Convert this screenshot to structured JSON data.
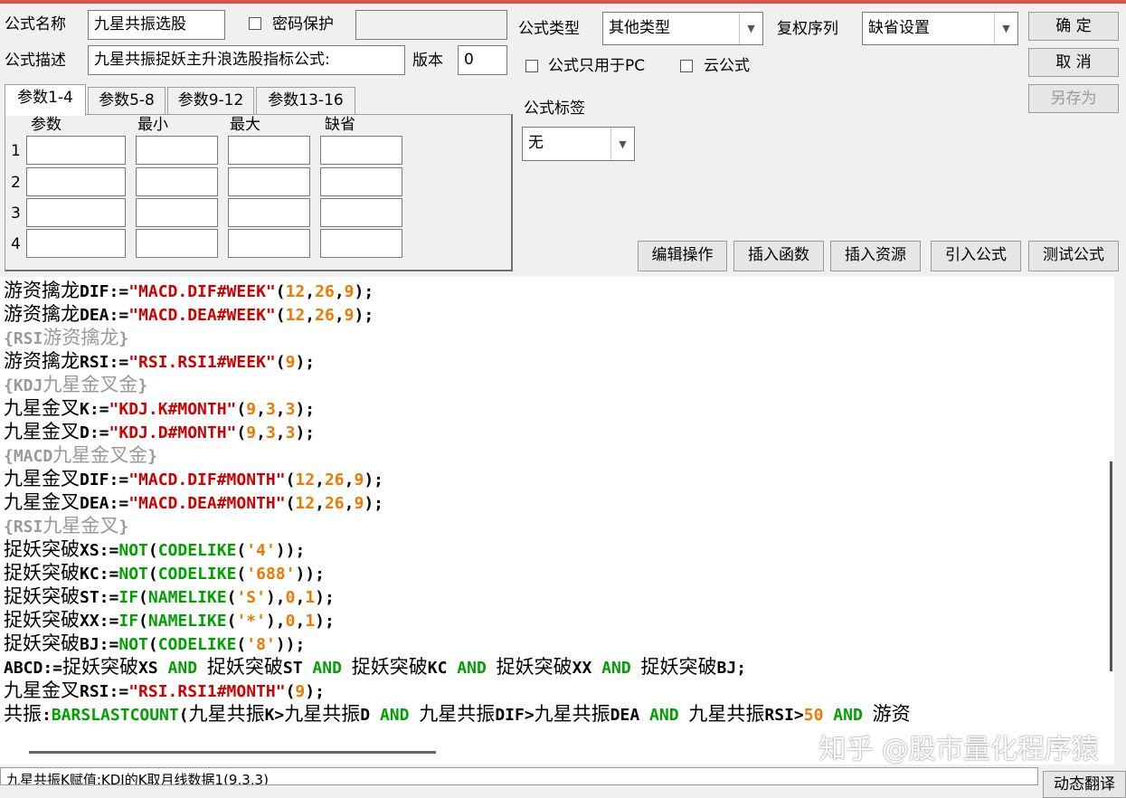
{
  "form": {
    "name_label": "公式名称",
    "name_value": "九星共振选股",
    "password_label": "密码保护",
    "desc_label": "公式描述",
    "desc_value": "九星共振捉妖主升浪选股指标公式:",
    "version_label": "版本",
    "version_value": "0",
    "type_label": "公式类型",
    "type_value": "其他类型",
    "rights_label": "复权序列",
    "rights_value": "缺省设置",
    "pc_only_label": "公式只用于PC",
    "cloud_label": "云公式",
    "tag_label": "公式标签",
    "tag_value": "无"
  },
  "buttons": {
    "ok": "确 定",
    "cancel": "取 消",
    "save_as": "另存为",
    "edit_ops": "编辑操作",
    "insert_func": "插入函数",
    "insert_res": "插入资源",
    "import_formula": "引入公式",
    "test_formula": "测试公式",
    "dynamic_translate": "动态翻译"
  },
  "params": {
    "tabs": [
      "参数1-4",
      "参数5-8",
      "参数9-12",
      "参数13-16"
    ],
    "headers": [
      "参数",
      "最小",
      "最大",
      "缺省"
    ],
    "rows": [
      "1",
      "2",
      "3",
      "4"
    ]
  },
  "code": [
    [
      [
        "cn",
        "k",
        "游资擒龙"
      ],
      [
        "",
        "k",
        "DIF:="
      ],
      [
        "",
        "s",
        "\"MACD.DIF#WEEK\""
      ],
      [
        "",
        "k",
        "("
      ],
      [
        "",
        "n",
        "12"
      ],
      [
        "",
        "k",
        ","
      ],
      [
        "",
        "n",
        "26"
      ],
      [
        "",
        "k",
        ","
      ],
      [
        "",
        "n",
        "9"
      ],
      [
        "",
        "k",
        ");"
      ]
    ],
    [
      [
        "cn",
        "k",
        "游资擒龙"
      ],
      [
        "",
        "k",
        "DEA:="
      ],
      [
        "",
        "s",
        "\"MACD.DEA#WEEK\""
      ],
      [
        "",
        "k",
        "("
      ],
      [
        "",
        "n",
        "12"
      ],
      [
        "",
        "k",
        ","
      ],
      [
        "",
        "n",
        "26"
      ],
      [
        "",
        "k",
        ","
      ],
      [
        "",
        "n",
        "9"
      ],
      [
        "",
        "k",
        ");"
      ]
    ],
    [
      [
        "",
        "c",
        "{RSI"
      ],
      [
        "cn",
        "c",
        "游资擒龙"
      ],
      [
        "",
        "c",
        "}"
      ]
    ],
    [
      [
        "cn",
        "k",
        "游资擒龙"
      ],
      [
        "",
        "k",
        "RSI:="
      ],
      [
        "",
        "s",
        "\"RSI.RSI1#WEEK\""
      ],
      [
        "",
        "k",
        "("
      ],
      [
        "",
        "n",
        "9"
      ],
      [
        "",
        "k",
        ");"
      ]
    ],
    [
      [
        "",
        "c",
        "{KDJ"
      ],
      [
        "cn",
        "c",
        "九星金叉金"
      ],
      [
        "",
        "c",
        "}"
      ]
    ],
    [
      [
        "cn",
        "k",
        "九星金叉"
      ],
      [
        "",
        "k",
        "K:="
      ],
      [
        "",
        "s",
        "\"KDJ.K#MONTH\""
      ],
      [
        "",
        "k",
        "("
      ],
      [
        "",
        "n",
        "9"
      ],
      [
        "",
        "k",
        ","
      ],
      [
        "",
        "n",
        "3"
      ],
      [
        "",
        "k",
        ","
      ],
      [
        "",
        "n",
        "3"
      ],
      [
        "",
        "k",
        ");"
      ]
    ],
    [
      [
        "cn",
        "k",
        "九星金叉"
      ],
      [
        "",
        "k",
        "D:="
      ],
      [
        "",
        "s",
        "\"KDJ.D#MONTH\""
      ],
      [
        "",
        "k",
        "("
      ],
      [
        "",
        "n",
        "9"
      ],
      [
        "",
        "k",
        ","
      ],
      [
        "",
        "n",
        "3"
      ],
      [
        "",
        "k",
        ","
      ],
      [
        "",
        "n",
        "3"
      ],
      [
        "",
        "k",
        ");"
      ]
    ],
    [
      [
        "",
        "c",
        "{MACD"
      ],
      [
        "cn",
        "c",
        "九星金叉金"
      ],
      [
        "",
        "c",
        "}"
      ]
    ],
    [
      [
        "cn",
        "k",
        "九星金叉"
      ],
      [
        "",
        "k",
        "DIF:="
      ],
      [
        "",
        "s",
        "\"MACD.DIF#MONTH\""
      ],
      [
        "",
        "k",
        "("
      ],
      [
        "",
        "n",
        "12"
      ],
      [
        "",
        "k",
        ","
      ],
      [
        "",
        "n",
        "26"
      ],
      [
        "",
        "k",
        ","
      ],
      [
        "",
        "n",
        "9"
      ],
      [
        "",
        "k",
        ");"
      ]
    ],
    [
      [
        "cn",
        "k",
        "九星金叉"
      ],
      [
        "",
        "k",
        "DEA:="
      ],
      [
        "",
        "s",
        "\"MACD.DEA#MONTH\""
      ],
      [
        "",
        "k",
        "("
      ],
      [
        "",
        "n",
        "12"
      ],
      [
        "",
        "k",
        ","
      ],
      [
        "",
        "n",
        "26"
      ],
      [
        "",
        "k",
        ","
      ],
      [
        "",
        "n",
        "9"
      ],
      [
        "",
        "k",
        ");"
      ]
    ],
    [
      [
        "",
        "c",
        "{RSI"
      ],
      [
        "cn",
        "c",
        "九星金叉"
      ],
      [
        "",
        "c",
        "}"
      ]
    ],
    [
      [
        "cn",
        "k",
        "捉妖突破"
      ],
      [
        "",
        "k",
        "XS:="
      ],
      [
        "",
        "f",
        "NOT"
      ],
      [
        "",
        "k",
        "("
      ],
      [
        "",
        "f",
        "CODELIKE"
      ],
      [
        "",
        "k",
        "("
      ],
      [
        "",
        "n",
        "'4'"
      ],
      [
        "",
        "k",
        "));"
      ]
    ],
    [
      [
        "cn",
        "k",
        "捉妖突破"
      ],
      [
        "",
        "k",
        "KC:="
      ],
      [
        "",
        "f",
        "NOT"
      ],
      [
        "",
        "k",
        "("
      ],
      [
        "",
        "f",
        "CODELIKE"
      ],
      [
        "",
        "k",
        "("
      ],
      [
        "",
        "n",
        "'688'"
      ],
      [
        "",
        "k",
        "));"
      ]
    ],
    [
      [
        "cn",
        "k",
        "捉妖突破"
      ],
      [
        "",
        "k",
        "ST:="
      ],
      [
        "",
        "f",
        "IF"
      ],
      [
        "",
        "k",
        "("
      ],
      [
        "",
        "f",
        "NAMELIKE"
      ],
      [
        "",
        "k",
        "("
      ],
      [
        "",
        "n",
        "'S'"
      ],
      [
        "",
        "k",
        "),"
      ],
      [
        "",
        "n",
        "0"
      ],
      [
        "",
        "k",
        ","
      ],
      [
        "",
        "n",
        "1"
      ],
      [
        "",
        "k",
        ");"
      ]
    ],
    [
      [
        "cn",
        "k",
        "捉妖突破"
      ],
      [
        "",
        "k",
        "XX:="
      ],
      [
        "",
        "f",
        "IF"
      ],
      [
        "",
        "k",
        "("
      ],
      [
        "",
        "f",
        "NAMELIKE"
      ],
      [
        "",
        "k",
        "("
      ],
      [
        "",
        "n",
        "'*'"
      ],
      [
        "",
        "k",
        "),"
      ],
      [
        "",
        "n",
        "0"
      ],
      [
        "",
        "k",
        ","
      ],
      [
        "",
        "n",
        "1"
      ],
      [
        "",
        "k",
        ");"
      ]
    ],
    [
      [
        "cn",
        "k",
        "捉妖突破"
      ],
      [
        "",
        "k",
        "BJ:="
      ],
      [
        "",
        "f",
        "NOT"
      ],
      [
        "",
        "k",
        "("
      ],
      [
        "",
        "f",
        "CODELIKE"
      ],
      [
        "",
        "k",
        "("
      ],
      [
        "",
        "n",
        "'8'"
      ],
      [
        "",
        "k",
        "));"
      ]
    ],
    [
      [
        "",
        "k",
        "ABCD:="
      ],
      [
        "cn",
        "k",
        "捉妖突破"
      ],
      [
        "",
        "k",
        "XS "
      ],
      [
        "",
        "f",
        "AND"
      ],
      [
        "",
        "k",
        " "
      ],
      [
        "cn",
        "k",
        "捉妖突破"
      ],
      [
        "",
        "k",
        "ST "
      ],
      [
        "",
        "f",
        "AND"
      ],
      [
        "",
        "k",
        " "
      ],
      [
        "cn",
        "k",
        "捉妖突破"
      ],
      [
        "",
        "k",
        "KC "
      ],
      [
        "",
        "f",
        "AND"
      ],
      [
        "",
        "k",
        " "
      ],
      [
        "cn",
        "k",
        "捉妖突破"
      ],
      [
        "",
        "k",
        "XX "
      ],
      [
        "",
        "f",
        "AND"
      ],
      [
        "",
        "k",
        " "
      ],
      [
        "cn",
        "k",
        "捉妖突破"
      ],
      [
        "",
        "k",
        "BJ;"
      ]
    ],
    [
      [
        "cn",
        "k",
        "九星金叉"
      ],
      [
        "",
        "k",
        "RSI:="
      ],
      [
        "",
        "s",
        "\"RSI.RSI1#MONTH\""
      ],
      [
        "",
        "k",
        "("
      ],
      [
        "",
        "n",
        "9"
      ],
      [
        "",
        "k",
        ");"
      ]
    ],
    [
      [
        "cn",
        "k",
        "共振"
      ],
      [
        "",
        "k",
        ":"
      ],
      [
        "",
        "f",
        "BARSLASTCOUNT"
      ],
      [
        "",
        "k",
        "("
      ],
      [
        "cn",
        "k",
        "九星共振"
      ],
      [
        "",
        "k",
        "K>"
      ],
      [
        "cn",
        "k",
        "九星共振"
      ],
      [
        "",
        "k",
        "D "
      ],
      [
        "",
        "f",
        "AND"
      ],
      [
        "",
        "k",
        " "
      ],
      [
        "cn",
        "k",
        "九星共振"
      ],
      [
        "",
        "k",
        "DIF>"
      ],
      [
        "cn",
        "k",
        "九星共振"
      ],
      [
        "",
        "k",
        "DEA "
      ],
      [
        "",
        "f",
        "AND"
      ],
      [
        "",
        "k",
        " "
      ],
      [
        "cn",
        "k",
        "九星共振"
      ],
      [
        "",
        "k",
        "RSI>"
      ],
      [
        "",
        "n",
        "50"
      ],
      [
        "",
        "k",
        " "
      ],
      [
        "",
        "f",
        "AND"
      ],
      [
        "",
        "k",
        " "
      ],
      [
        "cn",
        "k",
        "游资"
      ]
    ]
  ],
  "status_text": "九星共振K赋值:KDJ的K取月线数据1(9,3,3)",
  "watermark": "知乎 @股市量化程序猿",
  "colors": {
    "string": "#d00000",
    "number": "#f07800",
    "function": "#00a000",
    "comment": "#9a9a9a"
  }
}
